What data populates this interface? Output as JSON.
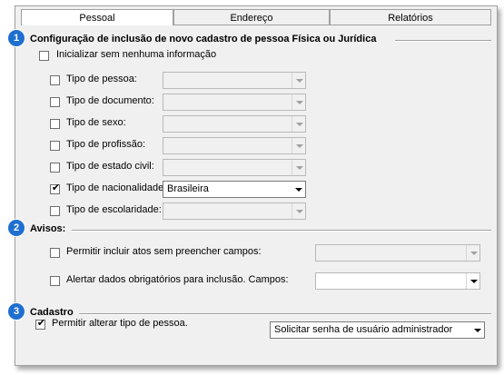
{
  "tabs": [
    {
      "label": "Pessoal"
    },
    {
      "label": "Endereço"
    },
    {
      "label": "Relatórios"
    }
  ],
  "section1": {
    "number": "1",
    "title": "Configuração de inclusão de novo cadastro de pessoa Física ou Jurídica",
    "init_label": "Inicializar sem nenhuma informação",
    "rows": [
      {
        "label": "Tipo de pessoa:",
        "checked": false,
        "value": ""
      },
      {
        "label": "Tipo de documento:",
        "checked": false,
        "value": ""
      },
      {
        "label": "Tipo de sexo:",
        "checked": false,
        "value": ""
      },
      {
        "label": "Tipo de profissão:",
        "checked": false,
        "value": ""
      },
      {
        "label": "Tipo de estado civil:",
        "checked": false,
        "value": ""
      },
      {
        "label": "Tipo de nacionalidade:",
        "checked": true,
        "value": "Brasileira"
      },
      {
        "label": "Tipo de escolaridade:",
        "checked": false,
        "value": ""
      }
    ]
  },
  "section2": {
    "number": "2",
    "title": "Avisos:",
    "rows": [
      {
        "label": "Permitir incluir atos sem preencher campos:",
        "checked": false,
        "value": ""
      },
      {
        "label": "Alertar dados obrigatórios para inclusão. Campos:",
        "checked": false,
        "value": ""
      }
    ]
  },
  "section3": {
    "number": "3",
    "title": "Cadastro",
    "checkbox_label": "Permitir alterar tipo de pessoa.",
    "checked": true,
    "select_value": "Solicitar senha de usuário administrador"
  },
  "check_glyph": "✔",
  "accent_color": "#1f6fd0"
}
